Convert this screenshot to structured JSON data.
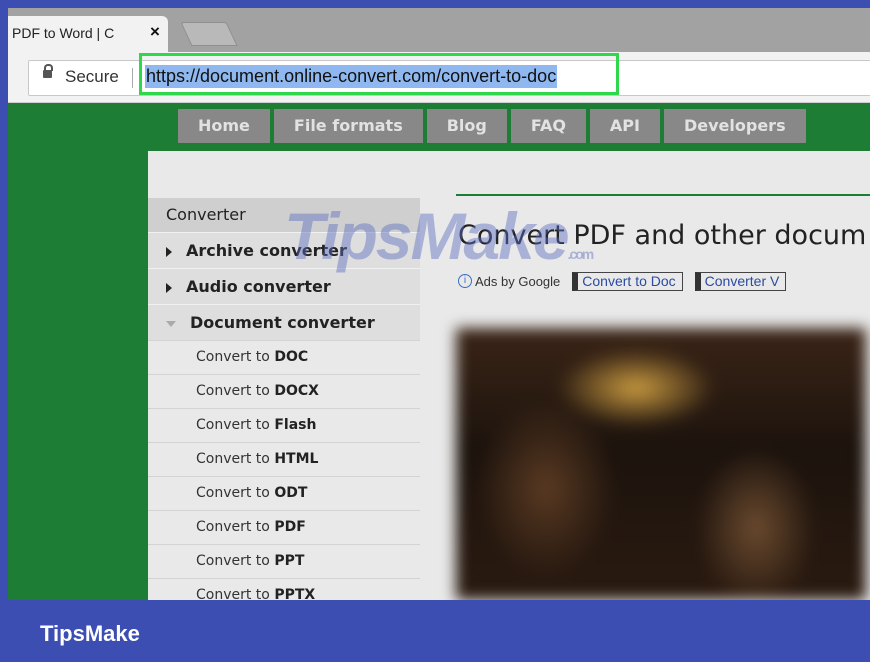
{
  "browser": {
    "tab_title": "PDF to Word | C",
    "tab_close": "×",
    "secure_label": "Secure",
    "url": "https://document.online-convert.com/convert-to-doc"
  },
  "nav": {
    "items": [
      {
        "label": "Home"
      },
      {
        "label": "File formats"
      },
      {
        "label": "Blog"
      },
      {
        "label": "FAQ"
      },
      {
        "label": "API"
      },
      {
        "label": "Developers"
      }
    ]
  },
  "sidebar": {
    "heading": "Converter",
    "categories": [
      {
        "label": "Archive converter"
      },
      {
        "label": "Audio converter"
      },
      {
        "label": "Document converter"
      }
    ],
    "links_prefix": "Convert to",
    "links": [
      "DOC",
      "DOCX",
      "Flash",
      "HTML",
      "ODT",
      "PDF",
      "PPT",
      "PPTX"
    ]
  },
  "main": {
    "title": "Convert PDF and other docum",
    "ads_label": "Ads by Google",
    "ad_links": [
      "Convert to Doc",
      "Converter V"
    ]
  },
  "watermark": {
    "text": "TipsMake",
    "suffix": ".com"
  },
  "footer": {
    "brand": "TipsMake"
  },
  "colors": {
    "accent_green": "#1e7d35",
    "highlight": "#2fd84a",
    "banner": "#3d4eb3"
  }
}
